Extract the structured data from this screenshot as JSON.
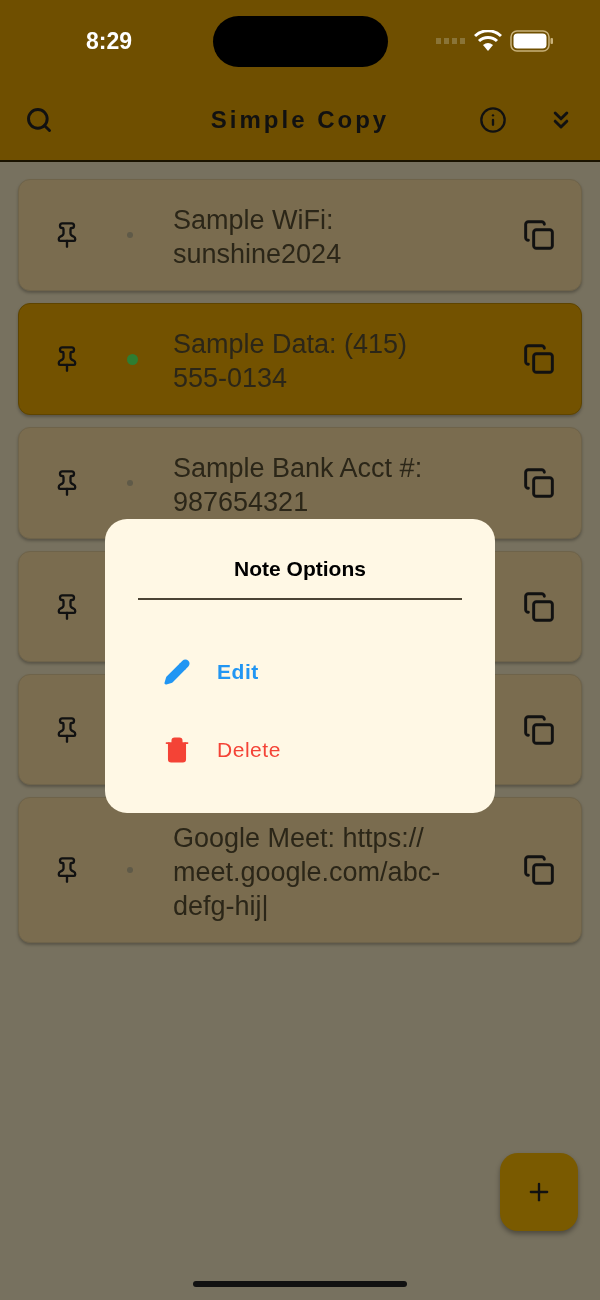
{
  "status_bar": {
    "time": "8:29"
  },
  "app_bar": {
    "title": "Simple Copy"
  },
  "notes": [
    {
      "lines": [
        "Sample WiFi:",
        "sunshine2024"
      ],
      "selected": false,
      "color": "#5f5a48"
    },
    {
      "lines": [
        "Sample Data: (415)",
        "555-0134"
      ],
      "selected": true,
      "color": "#2e7d32"
    },
    {
      "lines": [
        "Sample Bank Acct #:",
        "987654321"
      ],
      "selected": false,
      "color": "#5f5a48"
    },
    {
      "selected": false
    },
    {
      "selected": false
    },
    {
      "lines": [
        "Google Meet: https://",
        "meet.google.com/abc-",
        "defg-hij|"
      ],
      "selected": false,
      "color": "#5f5a48"
    }
  ],
  "dialog": {
    "title": "Note Options",
    "options": [
      {
        "kind": "edit",
        "label": "Edit"
      },
      {
        "kind": "delete",
        "label": "Delete"
      }
    ]
  }
}
